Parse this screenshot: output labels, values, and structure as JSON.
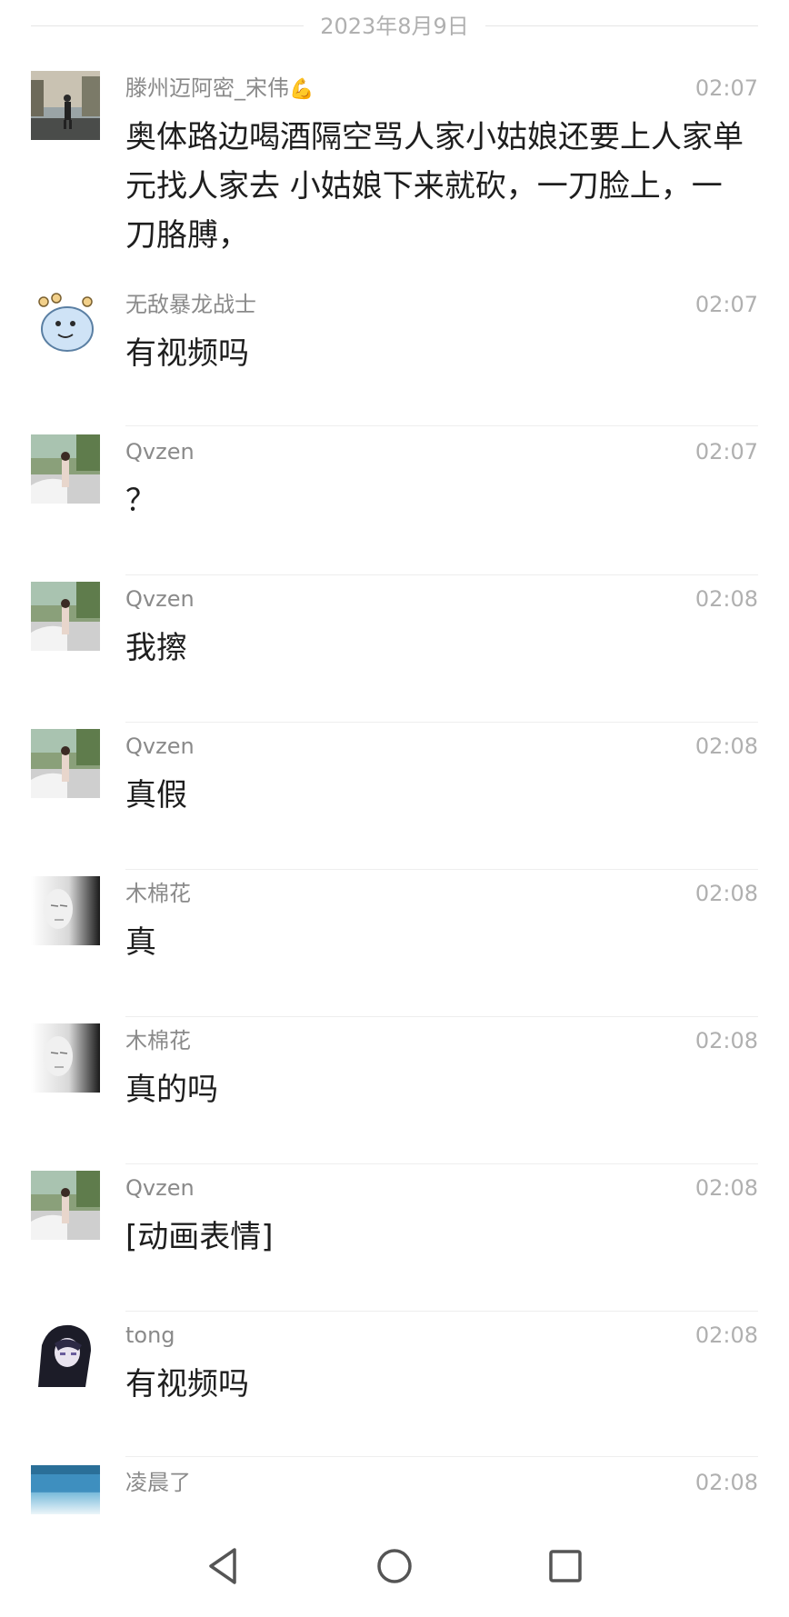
{
  "date_divider": "2023年8月9日",
  "messages": [
    {
      "sender": "滕州迈阿密_宋伟",
      "sender_emoji": "💪",
      "time": "02:07",
      "text": "奥体路边喝酒隔空骂人家小姑娘还要上人家单元找人家去 小姑娘下来就砍，一刀脸上，一刀胳膊，",
      "avatar": "photo-avatar-street"
    },
    {
      "sender": "无敌暴龙战士",
      "time": "02:07",
      "text": "有视频吗",
      "avatar": "cartoon-dino-avatar"
    },
    {
      "sender": "Qvzen",
      "time": "02:07",
      "text": "？",
      "avatar": "photo-avatar-car"
    },
    {
      "sender": "Qvzen",
      "time": "02:08",
      "text": "我擦",
      "avatar": "photo-avatar-car"
    },
    {
      "sender": "Qvzen",
      "time": "02:08",
      "text": "真假",
      "avatar": "photo-avatar-car"
    },
    {
      "sender": "木棉花",
      "time": "02:08",
      "text": "真",
      "avatar": "portrait-avatar-bw"
    },
    {
      "sender": "木棉花",
      "time": "02:08",
      "text": "真的吗",
      "avatar": "portrait-avatar-bw"
    },
    {
      "sender": "Qvzen",
      "time": "02:08",
      "text": "[动画表情]",
      "avatar": "photo-avatar-car"
    },
    {
      "sender": "tong",
      "time": "02:08",
      "text": "有视频吗",
      "avatar": "anime-avatar"
    },
    {
      "sender": "凌晨了",
      "time": "02:08",
      "text": "",
      "avatar": "photo-avatar-blue"
    }
  ],
  "nav": {
    "back_icon": "triangle-back-icon",
    "home_icon": "circle-home-icon",
    "recents_icon": "square-recents-icon"
  },
  "colors": {
    "background": "#ffffff",
    "sender": "#8a8a8a",
    "time": "#b0b0b0",
    "text": "#1e1e1e",
    "divider": "#eeeeee"
  }
}
